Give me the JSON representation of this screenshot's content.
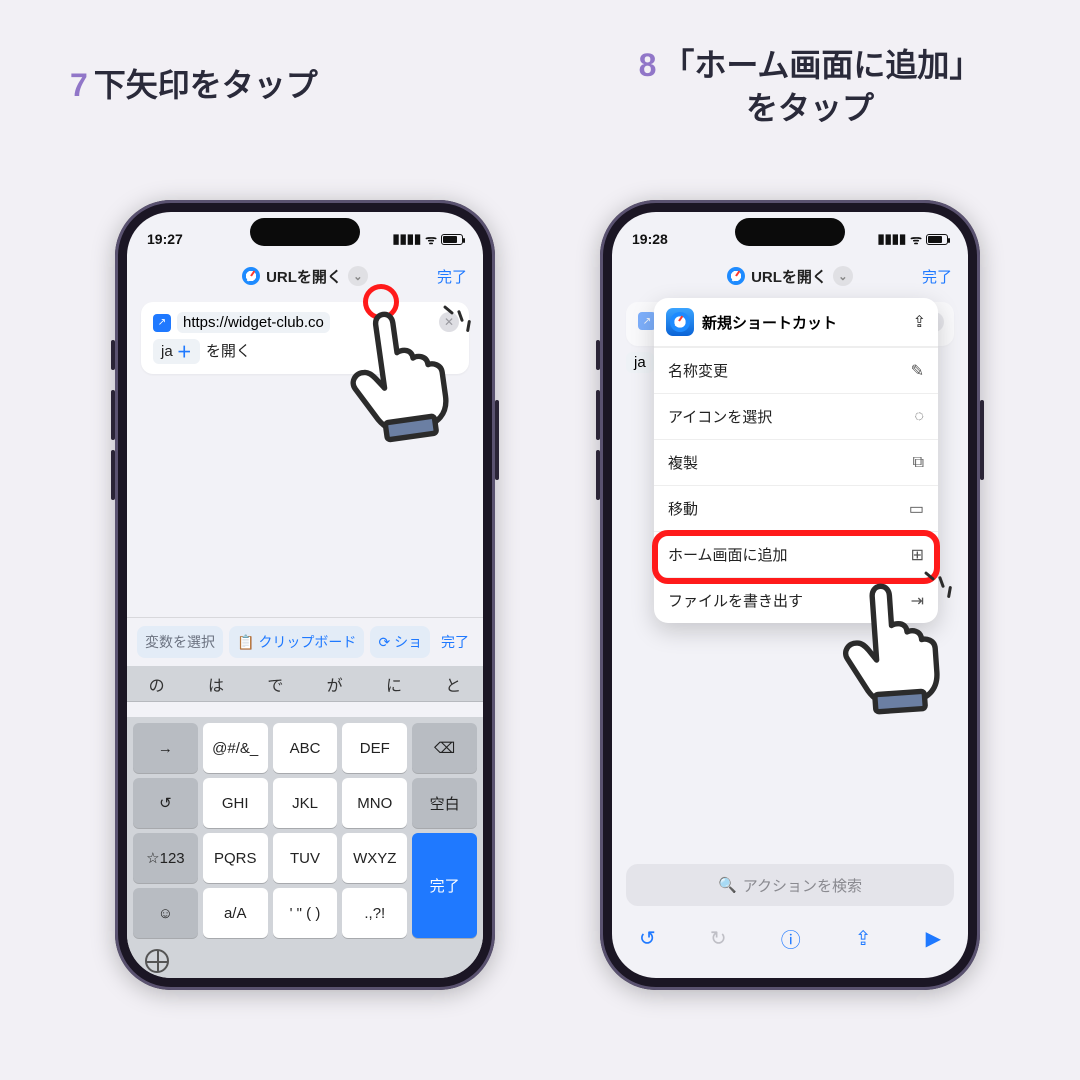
{
  "steps": {
    "s7": {
      "num": "7",
      "text": "下矢印をタップ"
    },
    "s8": {
      "num": "8",
      "text": "「ホーム画面に追加」\nをタップ"
    }
  },
  "phone1": {
    "time": "19:27",
    "header_title": "URLを開く",
    "done": "完了",
    "url": "https://widget-club.co",
    "ja_chip": "ja",
    "open_suffix": "を開く",
    "suggest": {
      "var": "変数を選択",
      "clip": "クリップボード",
      "short": "ショ",
      "done": "完了"
    },
    "predict": [
      "の",
      "は",
      "で",
      "が",
      "に",
      "と"
    ],
    "keys": {
      "r1": [
        "→",
        "@#/&_",
        "ABC",
        "DEF",
        "⌫"
      ],
      "r2": [
        "↺",
        "GHI",
        "JKL",
        "MNO",
        "空白"
      ],
      "r3": [
        "☆123",
        "PQRS",
        "TUV",
        "WXYZ",
        "完了"
      ],
      "r4": [
        "☺",
        "a/A",
        "' \" ( )",
        ".,?!",
        ""
      ]
    }
  },
  "phone2": {
    "time": "19:28",
    "header_title": "URLを開く",
    "done": "完了",
    "ja_chip": "ja",
    "popover": {
      "title": "新規ショートカット",
      "items": [
        {
          "label": "名称変更",
          "icon": "pencil-icon",
          "glyph": "✎"
        },
        {
          "label": "アイコンを選択",
          "icon": "dashed-square-icon",
          "glyph": "◌"
        },
        {
          "label": "複製",
          "icon": "copy-icon",
          "glyph": "⧉"
        },
        {
          "label": "移動",
          "icon": "folder-icon",
          "glyph": "▭"
        },
        {
          "label": "ホーム画面に追加",
          "icon": "add-to-home-icon",
          "glyph": "⊞"
        },
        {
          "label": "ファイルを書き出す",
          "icon": "export-icon",
          "glyph": "⇥"
        }
      ]
    },
    "search_placeholder": "アクションを検索"
  }
}
